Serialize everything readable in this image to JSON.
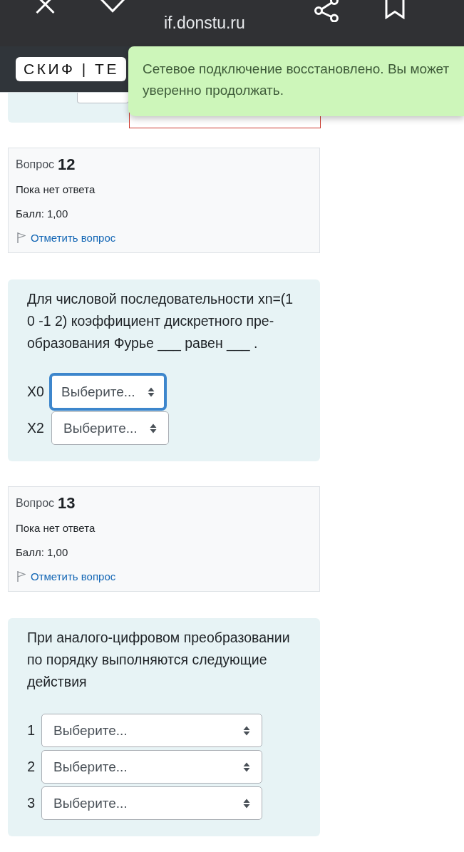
{
  "browser_bar": {
    "url": "if.donstu.ru"
  },
  "navbar": {
    "logo": "СКИФ | ТЕ"
  },
  "toast": {
    "message": "Сетевое подключение восстановлено. Вы может\nуверенно продолжать."
  },
  "questions": [
    {
      "kind": "compact",
      "label": "Вопрос",
      "number": "12",
      "status": "Пока нет ответа",
      "score": "Балл: 1,00",
      "flag_link": "Отметить вопрос",
      "flagged": false,
      "text": "Для числовой последовательности xn=(1\n0 -1 2) коэффициент дискретного пре-\nобразования Фурье ___ равен ___ .",
      "answers": [
        {
          "label": "X0",
          "value": "Выберите...",
          "focused": true
        },
        {
          "label": "X2",
          "value": "Выберите...",
          "focused": false
        }
      ]
    },
    {
      "kind": "wide",
      "label": "Вопрос",
      "number": "13",
      "status": "Пока нет ответа",
      "score": "Балл: 1,00",
      "flag_link": "Отметить вопрос",
      "flagged": false,
      "text": "При аналого-цифровом преобразовании\nпо порядку выполняются следующие\nдействия",
      "answers": [
        {
          "label": "1",
          "value": "Выберите...",
          "focused": false
        },
        {
          "label": "2",
          "value": "Выберите...",
          "focused": false
        },
        {
          "label": "3",
          "value": "Выберите...",
          "focused": false
        }
      ]
    }
  ]
}
